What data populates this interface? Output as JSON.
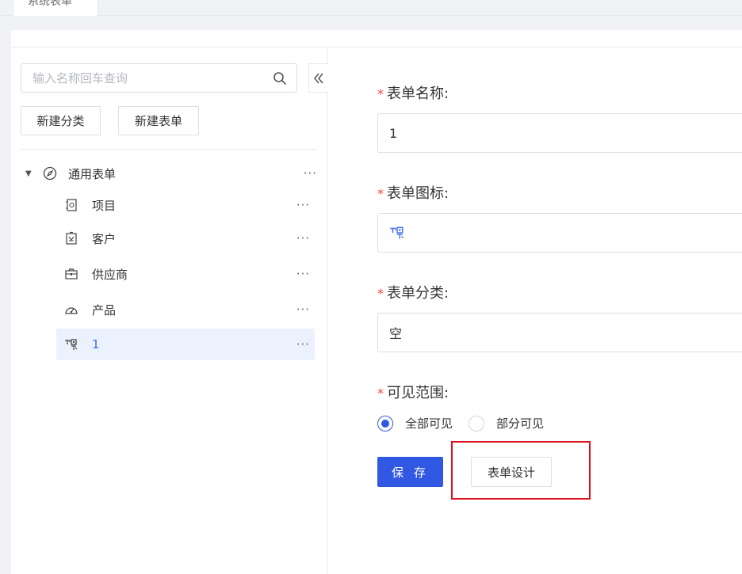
{
  "tabs": [
    {
      "label": "系统表单"
    }
  ],
  "sidebar": {
    "search": {
      "placeholder": "输入名称回车查询",
      "value": ""
    },
    "collapse_icon": "double-chevron-left-icon",
    "buttons": {
      "new_category": "新建分类",
      "new_form": "新建表单"
    },
    "tree": {
      "root": {
        "label": "通用表单",
        "icon": "compass-icon",
        "expanded": true,
        "more": "···"
      },
      "children": [
        {
          "label": "项目",
          "icon": "document-icon",
          "more": "···"
        },
        {
          "label": "客户",
          "icon": "contact-card-icon",
          "more": "···"
        },
        {
          "label": "供应商",
          "icon": "briefcase-icon",
          "more": "···"
        },
        {
          "label": "产品",
          "icon": "gauge-icon",
          "more": "···"
        },
        {
          "label": "1",
          "icon": "qr-code-icon",
          "more": "···",
          "selected": true
        }
      ]
    }
  },
  "form": {
    "required_mark": "*",
    "name": {
      "label": "表单名称:",
      "value": "1"
    },
    "icon": {
      "label": "表单图标:",
      "value_icon": "qr-code-icon"
    },
    "category": {
      "label": "表单分类:",
      "value": "空"
    },
    "visibility": {
      "label": "可见范围:",
      "options": [
        {
          "label": "全部可见",
          "checked": true
        },
        {
          "label": "部分可见",
          "checked": false
        }
      ]
    },
    "save_label": "保 存",
    "design_label": "表单设计"
  },
  "colors": {
    "primary": "#3158e3",
    "required": "#f0463c",
    "highlight": "#d9101a",
    "selected_bg": "#ecf2fd"
  }
}
